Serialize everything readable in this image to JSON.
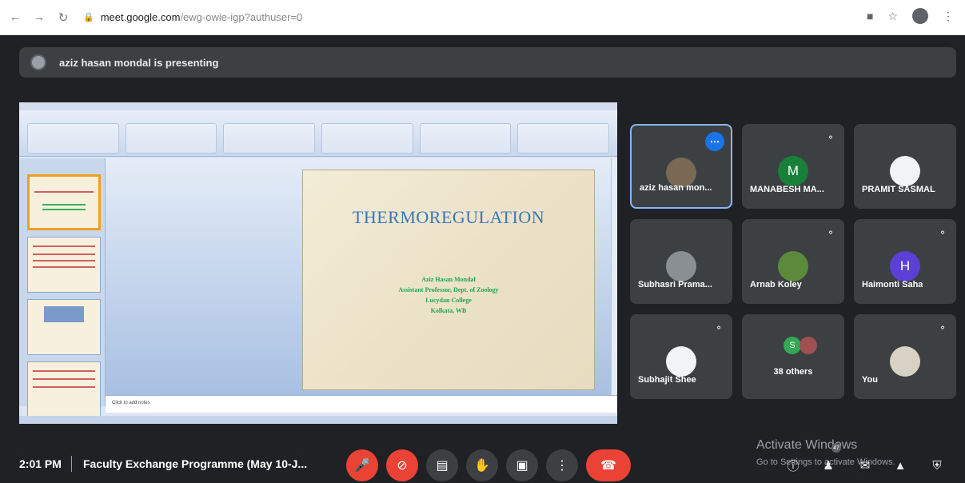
{
  "browser": {
    "url_host": "meet.google.com",
    "url_path": "/ewg-owie-igp?authuser=0"
  },
  "banner": {
    "text": "aziz hasan mondal is presenting"
  },
  "slide": {
    "title": "THERMOREGULATION",
    "lines": [
      "Aziz Hasan Mondal",
      "Assistant Professor, Dept. of Zoology",
      "Lucydan College",
      "Kolkata, WB"
    ],
    "notes_placeholder": "Click to add notes"
  },
  "participants": [
    {
      "name": "aziz hasan mon...",
      "initial": "",
      "avatar_color": "#7a6a55"
    },
    {
      "name": "MANABESH MA...",
      "initial": "M",
      "avatar_color": "#188038"
    },
    {
      "name": "PRAMIT SASMAL",
      "initial": "",
      "avatar_color": "#ffffff"
    },
    {
      "name": "Subhasri Prama...",
      "initial": "",
      "avatar_color": "#8a8f94"
    },
    {
      "name": "Arnab Koley",
      "initial": "",
      "avatar_color": "#5a8a3a"
    },
    {
      "name": "Haimonti Saha",
      "initial": "H",
      "avatar_color": "#5b3fd6"
    },
    {
      "name": "Subhajit Shee",
      "initial": "",
      "avatar_color": "#ffffff"
    },
    {
      "name": "38 others",
      "initial": "S",
      "avatar_color": "#34a853"
    },
    {
      "name": "You",
      "initial": "",
      "avatar_color": "#d8d2c4"
    }
  ],
  "footer": {
    "time": "2:01 PM",
    "meeting_name": "Faculty Exchange Programme (May 10-J...",
    "activate_title": "Activate Windows",
    "activate_sub": "Go to Settings to activate Windows.",
    "people_count": "47"
  }
}
